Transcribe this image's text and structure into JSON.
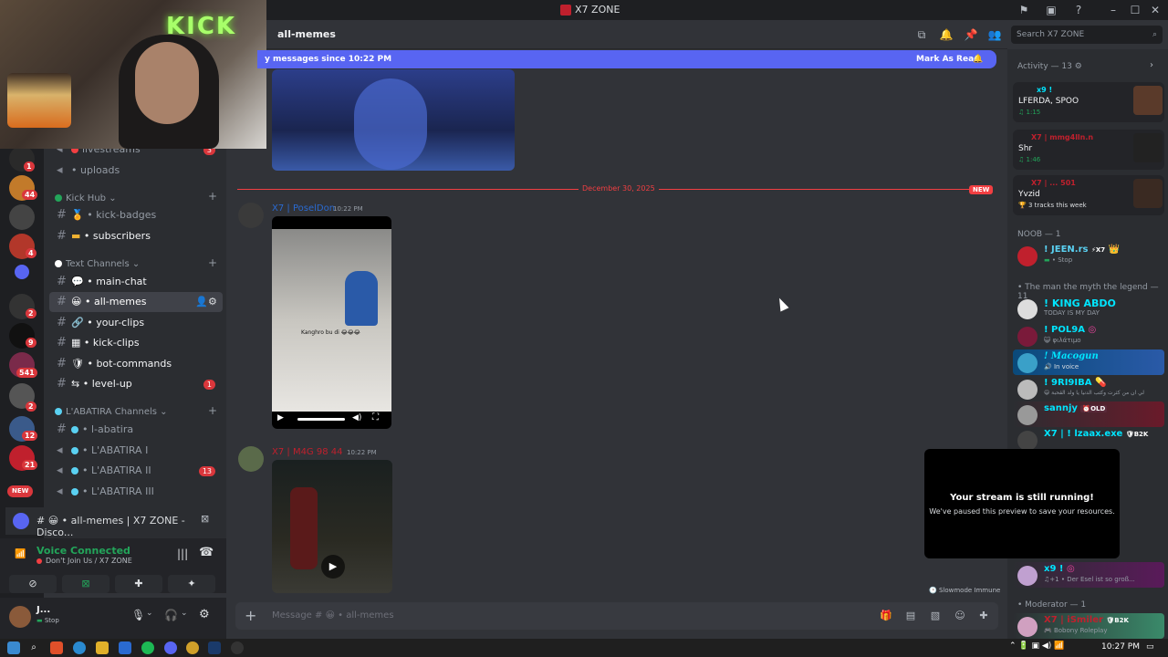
{
  "window": {
    "title": "X7 ZONE"
  },
  "rail": {
    "badges": [
      "1",
      "44",
      "4",
      "2",
      "9",
      "541",
      "2",
      "12",
      "21"
    ],
    "new_label": "NEW"
  },
  "sidebar": {
    "partial_channel": "livestreams",
    "partial_count": "3",
    "uploads": "uploads",
    "categories": {
      "kick_hub": "Kick Hub",
      "text_channels": "Text Channels",
      "labatira": "L'ABATIRA Channels"
    },
    "channels": [
      {
        "label": "kick-badges",
        "count": ""
      },
      {
        "label": "subscribers",
        "count": ""
      },
      {
        "label": "main-chat",
        "count": ""
      },
      {
        "label": "all-memes",
        "count": ""
      },
      {
        "label": "your-clips",
        "count": ""
      },
      {
        "label": "kick-clips",
        "count": ""
      },
      {
        "label": "bot-commands",
        "count": ""
      },
      {
        "label": "level-up",
        "count": "1"
      },
      {
        "label": "l-abatira",
        "count": ""
      },
      {
        "label": "L'ABATIRA I",
        "count": ""
      },
      {
        "label": "L'ABATIRA II",
        "count": "13"
      },
      {
        "label": "L'ABATIRA III",
        "count": ""
      }
    ]
  },
  "now_playing": {
    "text": "# 😀 • all-memes | X7 ZONE - Disco..."
  },
  "voice": {
    "status": "Voice Connected",
    "channel": "Don't Join Us / X7 ZONE"
  },
  "user": {
    "name": "J...",
    "status": "Stop"
  },
  "header": {
    "channel": "all-memes",
    "search_placeholder": "Search X7 ZONE"
  },
  "newbar": {
    "text": "y messages since 10:22 PM",
    "action": "Mark As Read"
  },
  "messages": {
    "date_divider": "December 30, 2025",
    "new_tag": "NEW",
    "msg1": {
      "author": "X7 | PoselDon",
      "time": "10:22 PM"
    },
    "msg2": {
      "author": "X7 | M4G 98 44",
      "time": "10:22 PM"
    },
    "video_caption": "Kanghro bu di 😂😂😂"
  },
  "slowmode": "Slowmode Immune",
  "composer": {
    "placeholder": "Message # 😀 • all-memes"
  },
  "members": {
    "activity_header": "Activity — 13",
    "activities": [
      {
        "name": "x9 !",
        "sub": "LFERDA, SPOO",
        "detail": "1:15"
      },
      {
        "name": "X7 | mmg4lln.n",
        "sub": "Shr",
        "detail": "1:46"
      },
      {
        "name": "X7 | ... 501",
        "sub": "Yvzid",
        "detail": "3 tracks this week"
      }
    ],
    "noob_header": "NOOB — 1",
    "noob": [
      {
        "name": "! JEEN.rs",
        "tag": "X7",
        "status": "Stop"
      }
    ],
    "legend_header": "The man the myth the legend — 11",
    "legend": [
      {
        "name": "! KING ABDO",
        "status": "TODAY IS MY DAY",
        "color": "#00e5ff"
      },
      {
        "name": "! POL9A",
        "status": "φιλάτιμο",
        "color": "#00e5ff"
      },
      {
        "name": "! Macogun",
        "status": "In voice",
        "color": "#00e5ff"
      },
      {
        "name": "! 9RI9IBA",
        "status": "لي ان من كثرت وكتب الدنيا يا ولد القحبة",
        "color": "#00e5ff"
      },
      {
        "name": "sannjy",
        "tag": "OLD",
        "status": "",
        "color": "#00e5ff"
      },
      {
        "name": "X7 | ! lzaax.exe",
        "tag": "B2K",
        "status": "",
        "color": "#00e5ff"
      },
      {
        "name": "x9 !",
        "status": "Der Esel ist so groß...",
        "color": "#00e5ff"
      }
    ],
    "moderator_header": "Moderator — 1",
    "moderator": [
      {
        "name": "X7 | iSmiler",
        "tag": "B2K",
        "status": "Bobony Roleplay"
      }
    ]
  },
  "toast": {
    "title": "Your stream is still running!",
    "body": "We've paused this preview to save your resources."
  },
  "taskbar": {
    "clock": "10:27 PM"
  }
}
